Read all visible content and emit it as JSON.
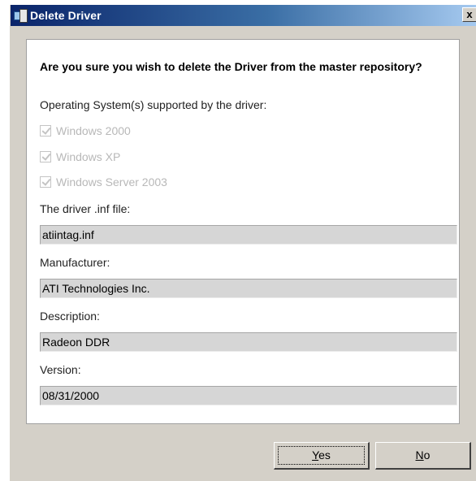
{
  "window": {
    "title": "Delete Driver",
    "close_glyph": "x"
  },
  "dialog": {
    "question": "Are you sure you wish to delete the Driver from the master repository?",
    "os_label": "Operating System(s) supported by the driver:",
    "os_options": [
      {
        "label": "Windows 2000",
        "checked": true,
        "disabled": true
      },
      {
        "label": "Windows XP",
        "checked": true,
        "disabled": true
      },
      {
        "label": "Windows Server 2003",
        "checked": true,
        "disabled": true
      }
    ],
    "inf_label": "The driver .inf file:",
    "inf_value": "atiintag.inf",
    "manufacturer_label": "Manufacturer:",
    "manufacturer_value": "ATI Technologies Inc.",
    "description_label": "Description:",
    "description_value": "Radeon DDR",
    "version_label": "Version:",
    "version_value": "08/31/2000"
  },
  "buttons": {
    "yes_mnemonic": "Y",
    "yes_rest": "es",
    "no_mnemonic": "N",
    "no_rest": "o"
  },
  "colors": {
    "titlebar_start": "#0a246a",
    "titlebar_end": "#a6caf0",
    "window_bg": "#d4d0c8",
    "field_bg": "#d6d6d6"
  },
  "icons": {
    "app": "app-icon",
    "close": "close-icon",
    "checkbox": "checkbox-checked-icon"
  }
}
